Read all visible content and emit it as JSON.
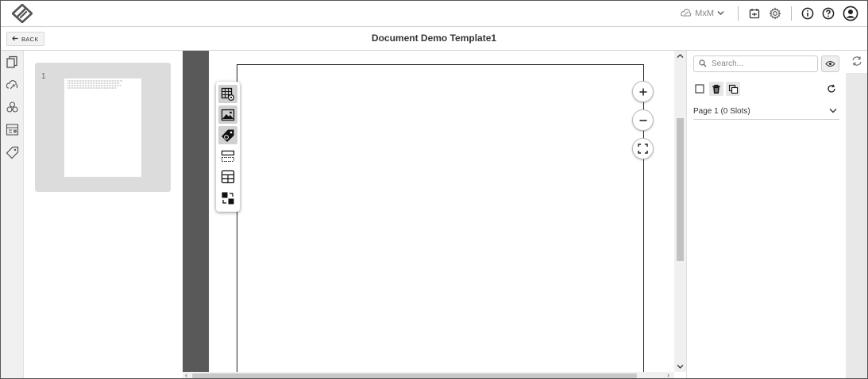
{
  "header": {
    "user_initials": "MxM",
    "icons": [
      "logo-icon",
      "cloud-user-icon",
      "chevron-down-icon",
      "export-icon",
      "gear-icon",
      "info-icon",
      "help-icon",
      "account-icon"
    ]
  },
  "titlebar": {
    "back_label": "BACK",
    "document_title": "Document Demo Template1"
  },
  "left_rail": {
    "icons": [
      "pages-icon",
      "cloud-data-icon",
      "components-icon",
      "form-fields-icon",
      "tags-icon"
    ]
  },
  "thumbnails": {
    "pages": [
      {
        "number": "1"
      }
    ]
  },
  "toolbox": {
    "tools": [
      "table-settings-tool",
      "image-tool",
      "tag-tool",
      "row-section-tool",
      "grid-table-tool",
      "swap-tool"
    ]
  },
  "zoom": {
    "in_symbol": "+",
    "out_symbol": "−"
  },
  "right_panel": {
    "search_placeholder": "Search...",
    "page_sections": [
      {
        "label": "Page 1 (0 Slots)"
      }
    ]
  },
  "colors": {
    "canvas_gray": "#595959",
    "panel_gray": "#dcdcdc",
    "accent": "#222222"
  }
}
